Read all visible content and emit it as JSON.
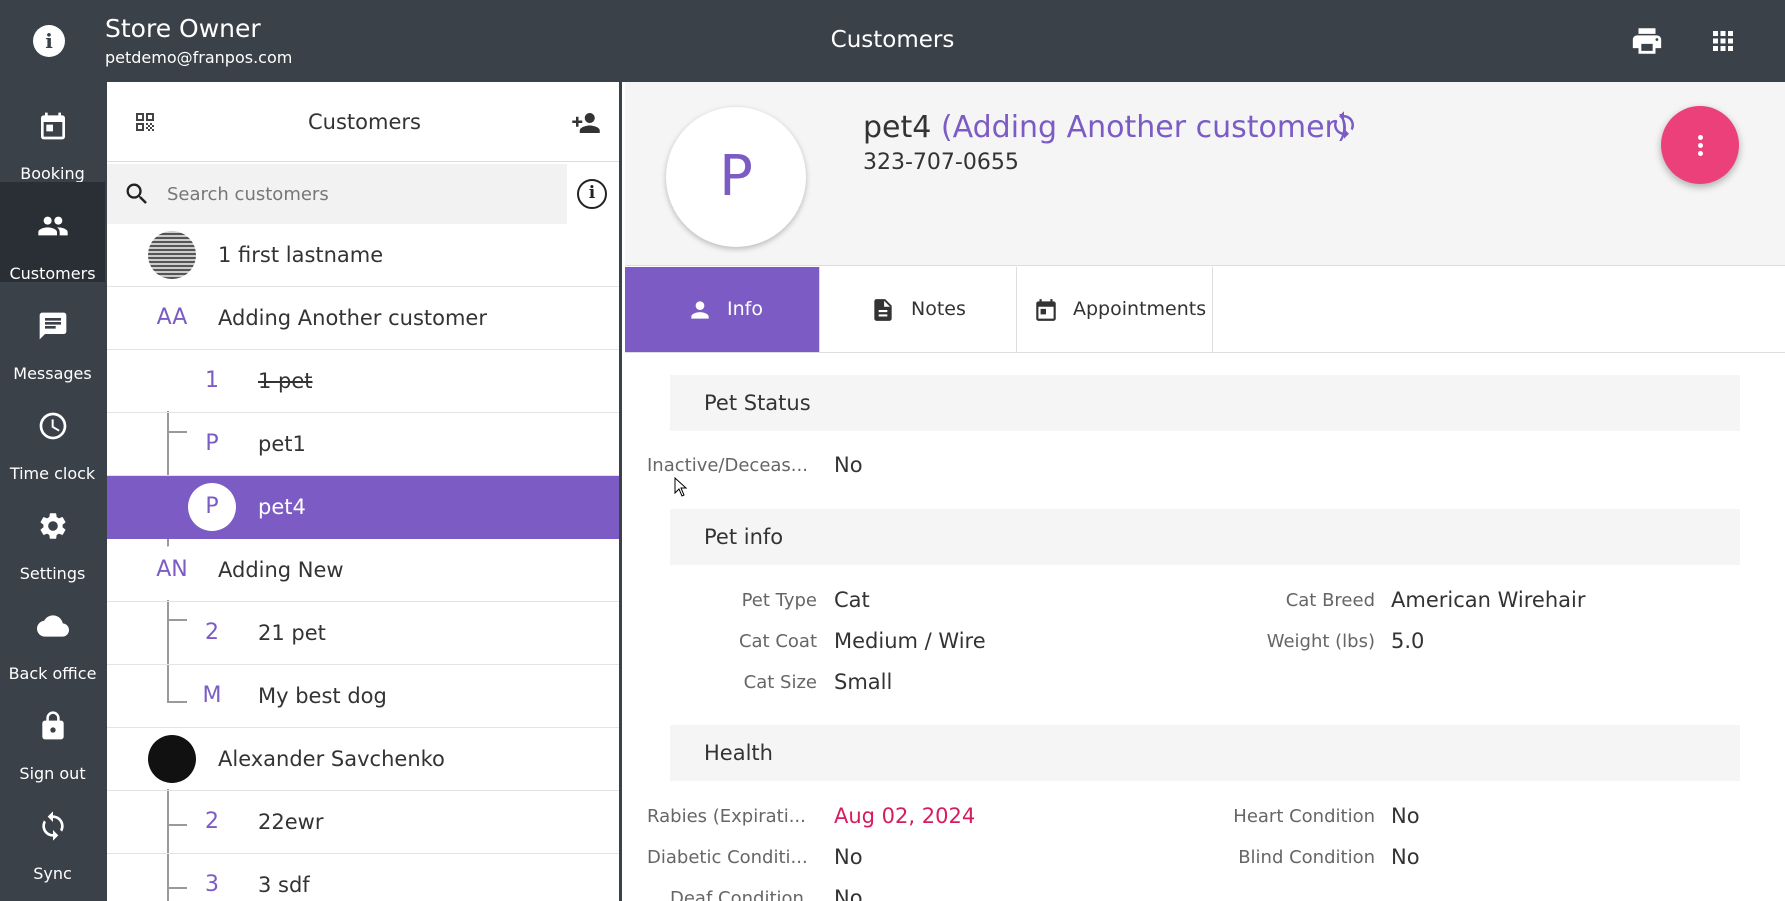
{
  "topbar": {
    "user_name": "Store Owner",
    "user_email": "petdemo@franpos.com",
    "page_title": "Customers",
    "icons": [
      "info-icon",
      "print-icon",
      "apps-grid-icon"
    ]
  },
  "nav": [
    {
      "label": "Booking",
      "icon": "calendar-icon"
    },
    {
      "label": "Customers",
      "icon": "people-icon",
      "active": true
    },
    {
      "label": "Messages",
      "icon": "chat-icon"
    },
    {
      "label": "Time clock",
      "icon": "clock-icon"
    },
    {
      "label": "Settings",
      "icon": "gear-icon"
    },
    {
      "label": "Back office",
      "icon": "cloud-icon"
    },
    {
      "label": "Sign out",
      "icon": "lock-icon"
    },
    {
      "label": "Sync",
      "icon": "sync-icon"
    }
  ],
  "list": {
    "title": "Customers",
    "search_placeholder": "Search customers",
    "rows": [
      {
        "type": "customer",
        "avatar": "",
        "label": "1 first lastname"
      },
      {
        "type": "customer",
        "avatar": "AA",
        "label": "Adding Another customer"
      },
      {
        "type": "pet",
        "avatar": "1",
        "label": "1 pet",
        "strikethrough": true
      },
      {
        "type": "pet",
        "avatar": "P",
        "label": "pet1"
      },
      {
        "type": "pet",
        "avatar": "P",
        "label": "pet4",
        "selected": true
      },
      {
        "type": "customer",
        "avatar": "AN",
        "label": "Adding New"
      },
      {
        "type": "pet",
        "avatar": "2",
        "label": "21 pet"
      },
      {
        "type": "pet",
        "avatar": "M",
        "label": "My best dog"
      },
      {
        "type": "customer",
        "avatar": "",
        "label": "Alexander Savchenko"
      },
      {
        "type": "pet",
        "avatar": "2",
        "label": "22ewr"
      },
      {
        "type": "pet",
        "avatar": "3",
        "label": "3 sdf"
      }
    ]
  },
  "detail": {
    "avatar": "P",
    "pet_name": "pet4",
    "owner": "(Adding Another customer)",
    "phone": "323-707-0655",
    "tabs": [
      {
        "label": "Info",
        "icon": "person-icon",
        "active": true
      },
      {
        "label": "Notes",
        "icon": "document-icon"
      },
      {
        "label": "Appointments",
        "icon": "calendar-icon"
      }
    ],
    "sections": {
      "status_title": "Pet Status",
      "info_title": "Pet info",
      "health_title": "Health"
    },
    "status": {
      "label": "Inactive/Deceas...",
      "value": "No"
    },
    "pet_info": {
      "pet_type": {
        "label": "Pet Type",
        "value": "Cat"
      },
      "cat_coat": {
        "label": "Cat Coat",
        "value": "Medium / Wire"
      },
      "cat_size": {
        "label": "Cat Size",
        "value": "Small"
      },
      "cat_breed": {
        "label": "Cat Breed",
        "value": "American Wirehair"
      },
      "weight": {
        "label": "Weight (lbs)",
        "value": "5.0"
      }
    },
    "health": {
      "rabies": {
        "label": "Rabies (Expirati...",
        "value": "Aug 02, 2024"
      },
      "diabetic": {
        "label": "Diabetic Conditi...",
        "value": "No"
      },
      "deaf": {
        "label": "Deaf Condition",
        "value": "No"
      },
      "heart": {
        "label": "Heart Condition",
        "value": "No"
      },
      "blind": {
        "label": "Blind Condition",
        "value": "No"
      }
    }
  },
  "colors": {
    "topbar": "#3b4149",
    "accent": "#7c5cc4",
    "fab": "#ec407a",
    "warning": "#d81b60"
  }
}
